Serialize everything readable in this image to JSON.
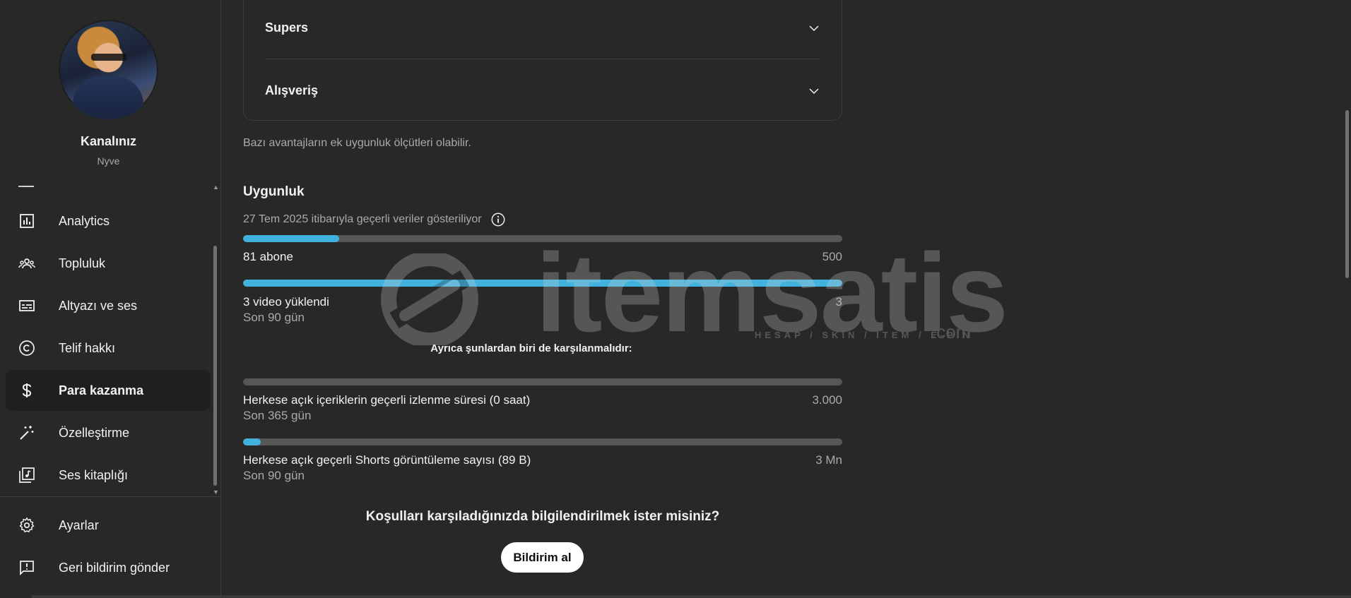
{
  "sidebar": {
    "channel_title": "Kanalınız",
    "channel_name": "Nyve",
    "items": [
      {
        "label": "Analytics",
        "icon": "analytics-icon"
      },
      {
        "label": "Topluluk",
        "icon": "community-icon"
      },
      {
        "label": "Altyazı ve ses",
        "icon": "subtitles-icon"
      },
      {
        "label": "Telif hakkı",
        "icon": "copyright-icon"
      },
      {
        "label": "Para kazanma",
        "icon": "dollar-icon",
        "active": true
      },
      {
        "label": "Özelleştirme",
        "icon": "magic-wand-icon"
      },
      {
        "label": "Ses kitaplığı",
        "icon": "audio-library-icon"
      }
    ],
    "bottom_items": [
      {
        "label": "Ayarlar",
        "icon": "gear-icon"
      },
      {
        "label": "Geri bildirim gönder",
        "icon": "feedback-icon"
      }
    ]
  },
  "main": {
    "accordion": [
      {
        "label": "Supers"
      },
      {
        "label": "Alışveriş"
      }
    ],
    "note": "Bazı avantajların ek uygunluk ölçütleri olabilir.",
    "eligibility": {
      "title": "Uygunluk",
      "data_date": "27 Tem 2025 itibarıyla geçerli veriler gösteriliyor",
      "metrics": [
        {
          "label": "81 abone",
          "target": "500",
          "sub": "",
          "progress": 0.16
        },
        {
          "label": "3 video yüklendi",
          "target": "3",
          "sub": "Son 90 gün",
          "progress": 1.0
        }
      ],
      "also_text": "Ayrıca şunlardan biri de karşılanmalıdır:",
      "alt_metrics": [
        {
          "label": "Herkese açık içeriklerin geçerli izlenme süresi (0 saat)",
          "target": "3.000",
          "sub": "Son 365 gün",
          "progress": 0.0
        },
        {
          "label": "Herkese açık geçerli Shorts görüntüleme sayısı (89 B)",
          "target": "3 Mn",
          "sub": "Son 90 gün",
          "progress": 0.03
        }
      ]
    },
    "notify": {
      "question": "Koşulları karşıladığınızda bilgilendirilmek ister misiniz?",
      "button": "Bildirim al"
    }
  },
  "watermark": {
    "text": "itemsatis",
    "sub": "HESAP / SKIN / ITEM / E-PIN",
    "suffix": ".com"
  },
  "colors": {
    "background": "#282828",
    "progress_fill": "#41b2dd",
    "progress_track": "#575757",
    "active_nav": "#1f1f1f"
  }
}
